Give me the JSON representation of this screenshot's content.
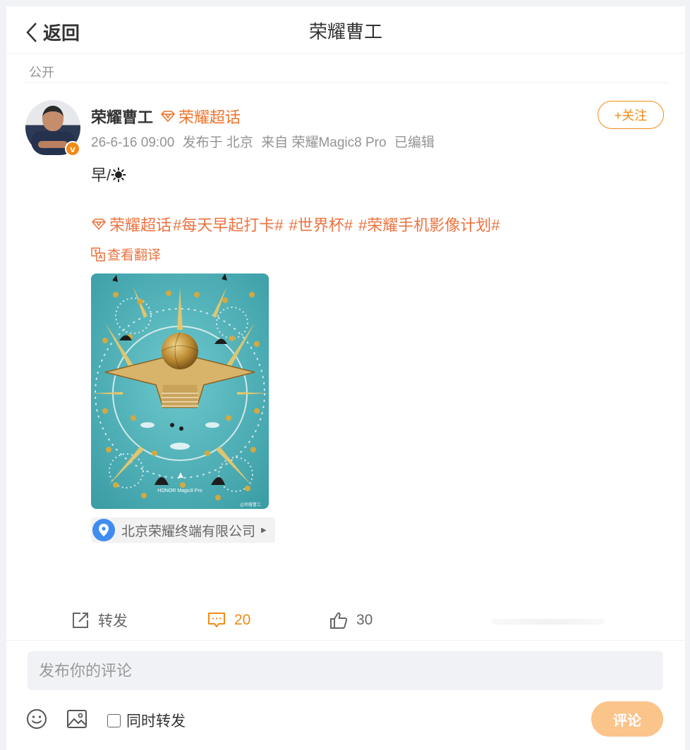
{
  "header": {
    "back_label": "返回",
    "title": "荣耀曹工"
  },
  "visibility": "公开",
  "post": {
    "author": "荣耀曹工",
    "super_topic": "荣耀超话",
    "follow_label": "+关注",
    "time": "26-6-16 09:00",
    "published_from": "发布于 北京",
    "source": "来自 荣耀Magic8 Pro",
    "edited": "已编辑",
    "text": "早/",
    "tags": [
      "荣耀超话",
      "#每天早起打卡#",
      "#世界杯#",
      "#荣耀手机影像计划#"
    ],
    "translate_label": "查看翻译",
    "location": "北京荣耀终端有限公司",
    "photo_watermark": "HONOR Magic8 Pro",
    "photo_credit": "@荣耀曹工"
  },
  "actions": {
    "repost_label": "转发",
    "comment_count": "20",
    "like_count": "30"
  },
  "composer": {
    "placeholder": "发布你的评论",
    "repost_option": "同时转发",
    "submit_label": "评论"
  },
  "colors": {
    "accent": "#f28a16",
    "topic": "#eb7340",
    "submit_bg": "#fbc48a"
  }
}
